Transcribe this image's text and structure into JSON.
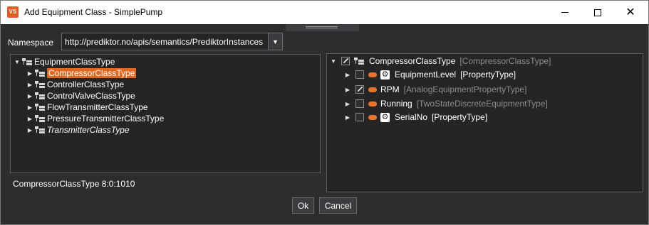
{
  "window": {
    "title": "Add Equipment Class - SimplePump",
    "app_icon_text": "VS"
  },
  "namespace": {
    "label": "Namespace",
    "value": "http://prediktor.no/apis/semantics/PrediktorInstances"
  },
  "left_tree": {
    "root": "EquipmentClassType",
    "items": [
      {
        "label": "CompressorClassType",
        "selected": true,
        "italic": false
      },
      {
        "label": "ControllerClassType",
        "selected": false,
        "italic": false
      },
      {
        "label": "ControlValveClassType",
        "selected": false,
        "italic": false
      },
      {
        "label": "FlowTransmitterClassType",
        "selected": false,
        "italic": false
      },
      {
        "label": "PressureTransmitterClassType",
        "selected": false,
        "italic": false
      },
      {
        "label": "TransmitterClassType",
        "selected": false,
        "italic": true
      }
    ]
  },
  "status_text": "CompressorClassType 8:0:1010",
  "right_tree": {
    "root": {
      "label": "CompressorClassType",
      "type": "[CompressorClassType]",
      "checked": true
    },
    "items": [
      {
        "label": "EquipmentLevel",
        "type": "[PropertyType]",
        "checked": false,
        "gear": true,
        "type_dim": false
      },
      {
        "label": "RPM",
        "type": "[AnalogEquipmentPropertyType]",
        "checked": true,
        "gear": false,
        "type_dim": true
      },
      {
        "label": "Running",
        "type": "[TwoStateDiscreteEquipmentType]",
        "checked": false,
        "gear": false,
        "type_dim": true
      },
      {
        "label": "SerialNo",
        "type": "[PropertyType]",
        "checked": false,
        "gear": true,
        "type_dim": false
      }
    ]
  },
  "buttons": {
    "ok": "Ok",
    "cancel": "Cancel"
  },
  "colors": {
    "selection": "#e2681f",
    "property_icon": "#e8742a",
    "background": "#2d2d30"
  }
}
